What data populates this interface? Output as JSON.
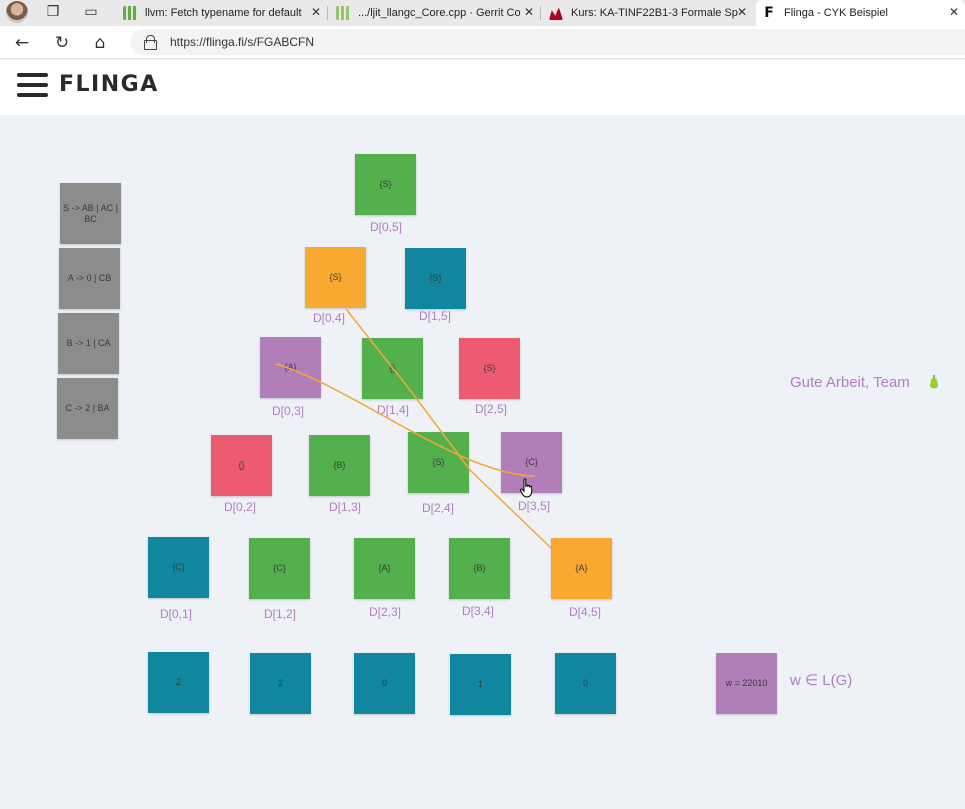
{
  "browser": {
    "tabs": [
      {
        "title": "llvm: Fetch typename for default",
        "icon": "llvm-favicon",
        "active": false
      },
      {
        "title": ".../ljit_llangc_Core.cpp · Gerrit Co",
        "icon": "gerrit-favicon",
        "active": false
      },
      {
        "title": "Kurs: KA-TINF22B1-3 Formale Sp",
        "icon": "moodle-favicon",
        "active": false
      },
      {
        "title": "Flinga - CYK Beispiel",
        "icon": "flinga-favicon",
        "active": true
      }
    ],
    "url": "https://flinga.fi/s/FGABCFN",
    "flinga_favicon_letter": "F",
    "close_glyph": "✕",
    "back_glyph": "←",
    "reload_glyph": "↻",
    "home_glyph": "⌂"
  },
  "app": {
    "logo": "FLINGA"
  },
  "grammar": [
    "S -> AB | AC | BC",
    "A -> 0 | CB",
    "B -> 1 | CA",
    "C -> 2 | BA"
  ],
  "cells": {
    "d05": {
      "value": "{S}",
      "label": "D[0,5]",
      "color": "#54b04c"
    },
    "d04": {
      "value": "{S}",
      "label": "D[0,4]",
      "color": "#f9a832"
    },
    "d15": {
      "value": "{S}",
      "label": "D[1,5]",
      "color": "#10879f"
    },
    "d03": {
      "value": "{A}",
      "label": "D[0,3]",
      "color": "#b07eb9"
    },
    "d14": {
      "value": "{}",
      "label": "D[1,4]",
      "color": "#54b04c"
    },
    "d25": {
      "value": "{S}",
      "label": "D[2,5]",
      "color": "#ec5b72"
    },
    "d02": {
      "value": "{}",
      "label": "D[0,2]",
      "color": "#ec5b72"
    },
    "d13": {
      "value": "{B}",
      "label": "D[1,3]",
      "color": "#54b04c"
    },
    "d24": {
      "value": "{S}",
      "label": "D[2,4]",
      "color": "#54b04c"
    },
    "d35": {
      "value": "{C}",
      "label": "D[3,5]",
      "color": "#b07eb9"
    },
    "d01": {
      "value": "{C}",
      "label": "D[0,1]",
      "color": "#10879f"
    },
    "d12": {
      "value": "{C}",
      "label": "D[1,2]",
      "color": "#54b04c"
    },
    "d23": {
      "value": "{A}",
      "label": "D[2,3]",
      "color": "#54b04c"
    },
    "d34": {
      "value": "{B}",
      "label": "D[3,4]",
      "color": "#54b04c"
    },
    "d45": {
      "value": "{A}",
      "label": "D[4,5]",
      "color": "#f9a832"
    }
  },
  "input_symbols": [
    "2",
    "2",
    "0",
    "1",
    "0"
  ],
  "word_card": "w = 22010",
  "membership_note": "w ∈ L(G)",
  "praise_note": "Gute Arbeit, Team",
  "connector_color": "#f4a73a"
}
